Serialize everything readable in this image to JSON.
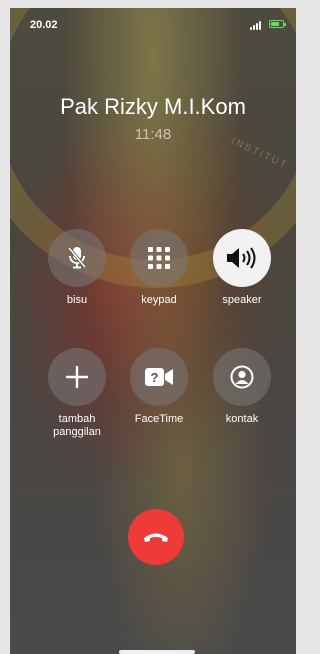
{
  "status": {
    "time": "20.02"
  },
  "call": {
    "caller_name": "Pak Rizky M.I.Kom",
    "duration": "11:48"
  },
  "watermark_text": "INSTITUT",
  "controls": {
    "mute": {
      "label": "bisu",
      "icon": "mic-slash-icon"
    },
    "keypad": {
      "label": "keypad",
      "icon": "keypad-grid-icon"
    },
    "speaker": {
      "label": "speaker",
      "icon": "speaker-icon",
      "active": true
    },
    "add_call": {
      "label": "tambah\npanggilan",
      "icon": "plus-icon"
    },
    "facetime": {
      "label": "FaceTime",
      "icon": "video-camera-icon"
    },
    "contacts": {
      "label": "kontak",
      "icon": "person-circle-icon"
    }
  },
  "end_call": {
    "icon": "phone-hangup-icon",
    "color": "#ee3b37"
  }
}
